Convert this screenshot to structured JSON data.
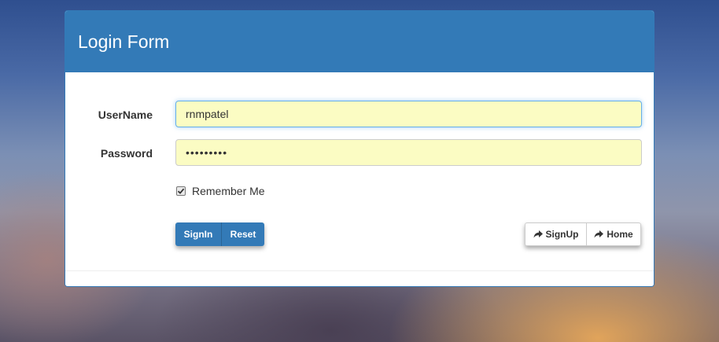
{
  "panel": {
    "title": "Login Form"
  },
  "form": {
    "username_label": "UserName",
    "username_value": "rnmpatel",
    "password_label": "Password",
    "password_value": "•••••••••",
    "remember_label": "Remember Me",
    "remember_checked": true
  },
  "buttons": {
    "signin_label": "SignIn",
    "reset_label": "Reset",
    "signup_label": "SignUp",
    "home_label": "Home"
  },
  "icons": {
    "signup_icon": "share-arrow-icon",
    "home_icon": "share-arrow-icon"
  },
  "colors": {
    "primary": "#337ab7",
    "autofill": "#fbfcc3",
    "focus": "#66afe9"
  }
}
